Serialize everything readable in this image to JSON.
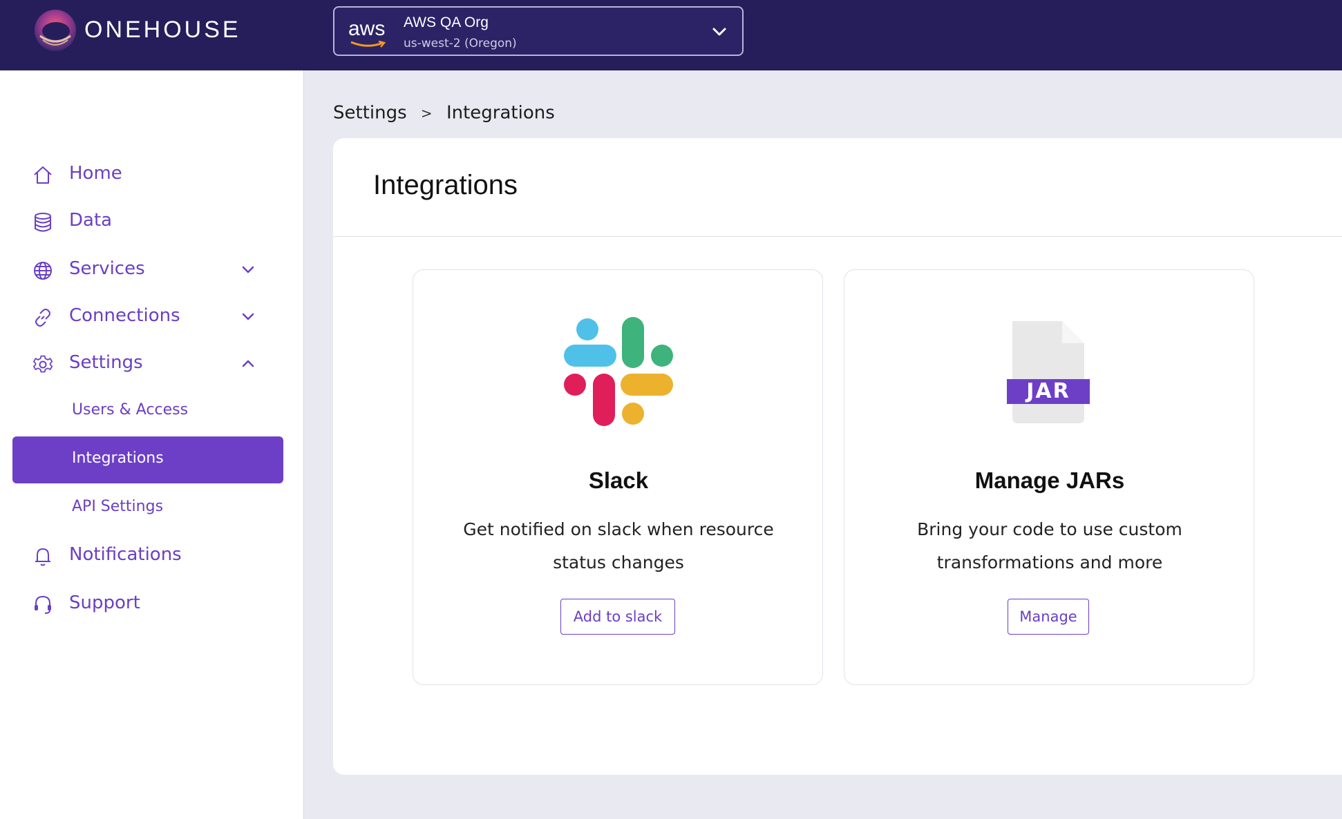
{
  "header": {
    "brand": "ONEHOUSE",
    "org": {
      "provider": "aws",
      "name": "AWS QA Org",
      "region": "us-west-2 (Oregon)"
    }
  },
  "sidebar": {
    "items": [
      {
        "label": "Home",
        "icon": "home-icon"
      },
      {
        "label": "Data",
        "icon": "database-icon"
      },
      {
        "label": "Services",
        "icon": "globe-icon",
        "expanded": false
      },
      {
        "label": "Connections",
        "icon": "link-icon",
        "expanded": false
      },
      {
        "label": "Settings",
        "icon": "gear-icon",
        "expanded": true
      },
      {
        "label": "Notifications",
        "icon": "bell-icon"
      },
      {
        "label": "Support",
        "icon": "headset-icon"
      }
    ],
    "settings_sub": [
      {
        "label": "Users & Access",
        "active": false
      },
      {
        "label": "Integrations",
        "active": true
      },
      {
        "label": "API Settings",
        "active": false
      }
    ]
  },
  "breadcrumb": {
    "parent": "Settings",
    "separator": ">",
    "current": "Integrations"
  },
  "page": {
    "title": "Integrations",
    "cards": [
      {
        "title": "Slack",
        "description": "Get notified on slack when resource status changes",
        "button": "Add to slack",
        "icon": "slack-icon"
      },
      {
        "title": "Manage JARs",
        "description": "Bring your code to use custom transformations and more",
        "button": "Manage",
        "icon": "jar-file-icon",
        "icon_text": "JAR"
      }
    ]
  },
  "colors": {
    "topbar": "#261e5a",
    "accent": "#6d3fc7",
    "page_bg": "#e9e9f1"
  }
}
